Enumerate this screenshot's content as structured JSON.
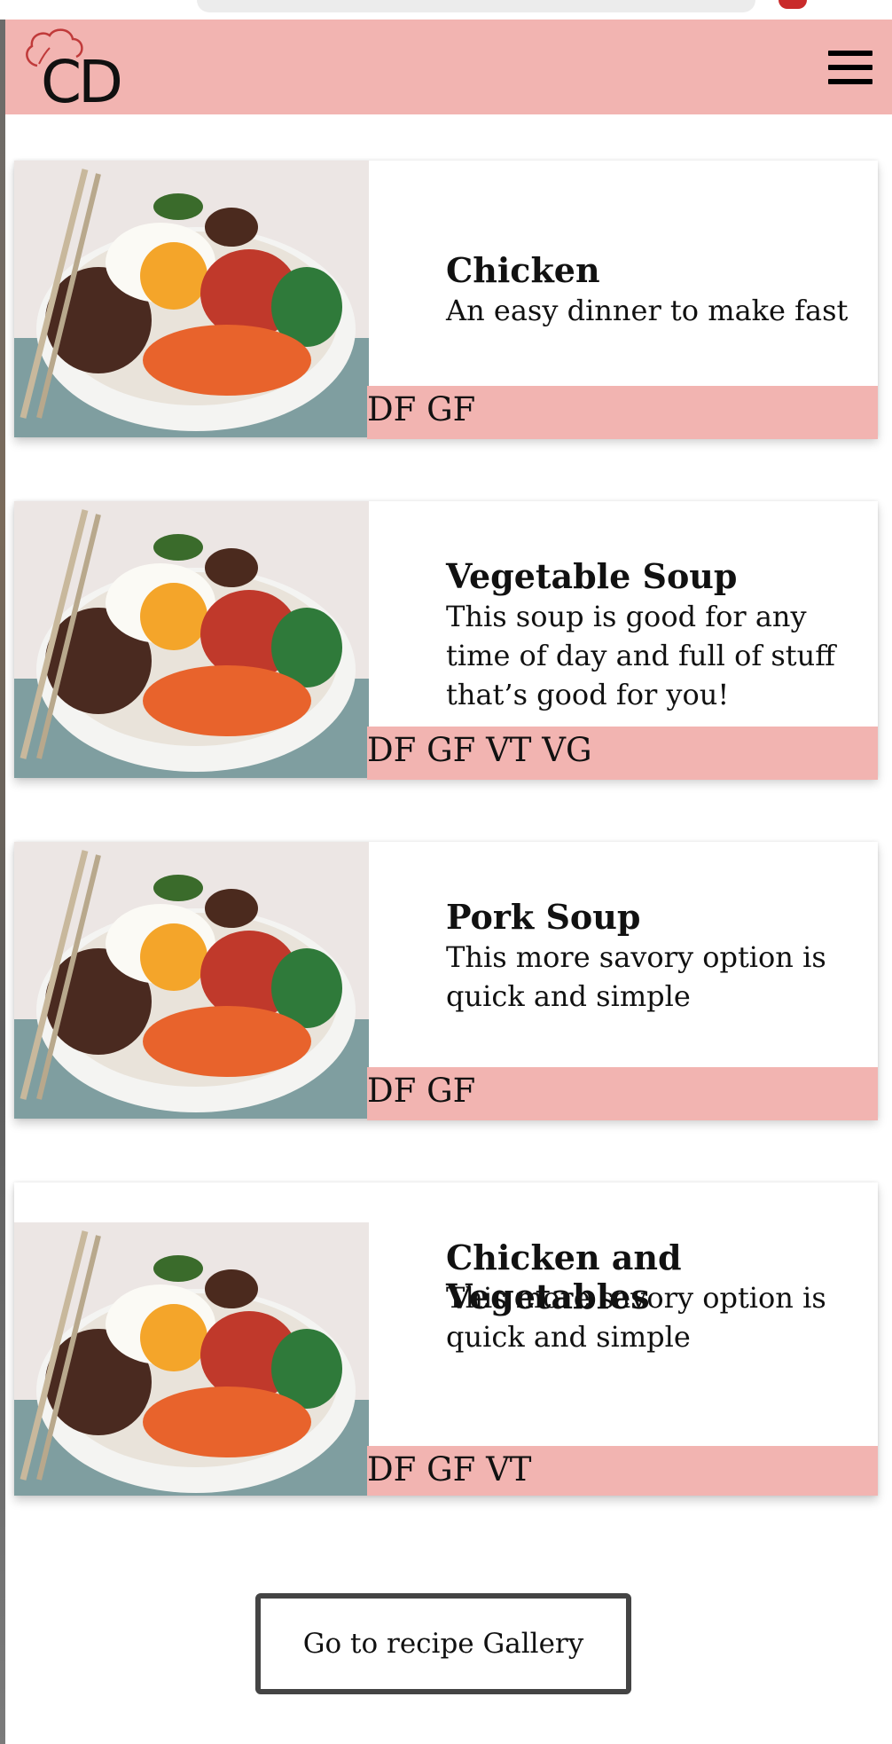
{
  "header": {
    "logo_text": "CD",
    "menu_icon": "hamburger-menu-icon"
  },
  "cards": [
    {
      "title": "Chicken",
      "description": "An easy dinner to make fast",
      "tags": "DF GF"
    },
    {
      "title": "Vegetable Soup",
      "description": "This soup is good for any time of day and full of stuff that’s good for you!",
      "tags": "DF GF VT VG"
    },
    {
      "title": "Pork Soup",
      "description": "This more savory option is quick and simple",
      "tags": "DF GF"
    },
    {
      "title": "Chicken and Vegetables",
      "description": "This more savory option is quick and simple",
      "tags": "DF GF VT"
    }
  ],
  "footer": {
    "gallery_button_label": "Go to recipe Gallery"
  },
  "colors": {
    "accent_pink": "#f2b4b1",
    "text": "#111111",
    "button_border": "#444444"
  }
}
